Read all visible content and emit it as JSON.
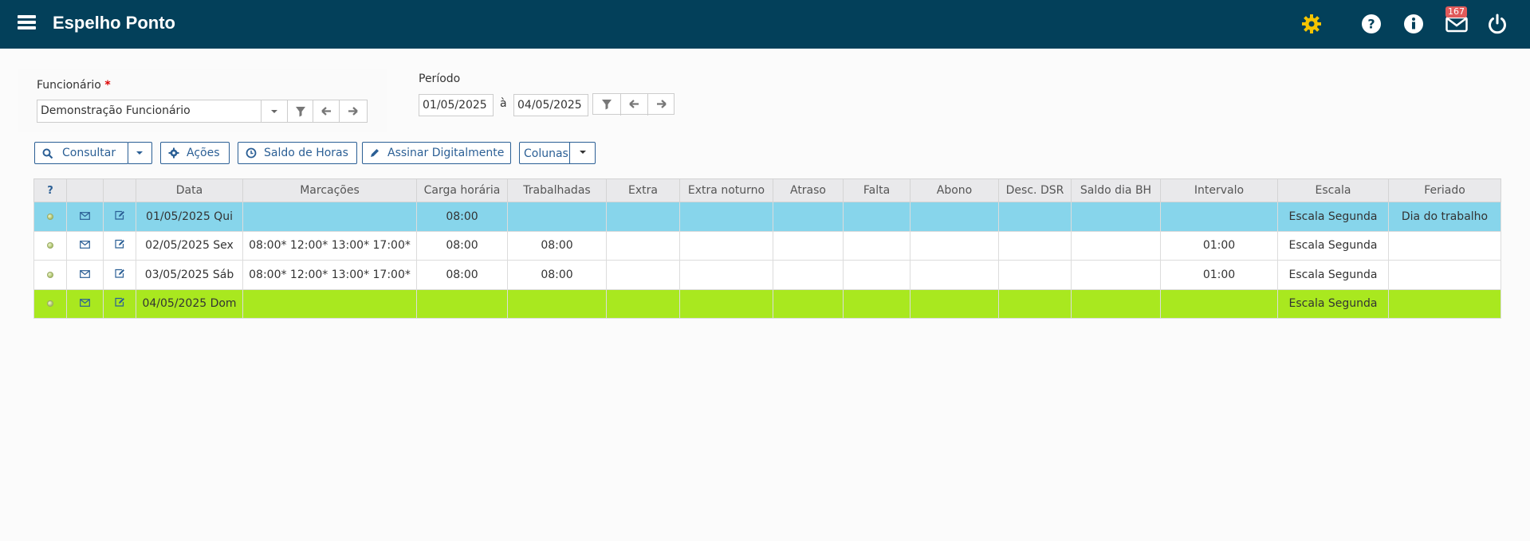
{
  "header": {
    "title": "Espelho Ponto",
    "mail_badge": "167",
    "icons": [
      "menu-icon",
      "gear-icon",
      "help-icon",
      "info-icon",
      "mail-icon",
      "power-icon"
    ],
    "colors": {
      "bar": "#03405a",
      "gear": "#f5c400",
      "badge": "#e05a5a"
    }
  },
  "filters": {
    "funcionario_label": "Funcionário",
    "required_mark": "*",
    "funcionario_value": "Demonstração Funcionário",
    "periodo_label": "Período",
    "start_date": "01/05/2025",
    "date_separator": "à",
    "end_date": "04/05/2025"
  },
  "toolbar": {
    "consultar": "Consultar",
    "acoes": "Ações",
    "saldo_horas": "Saldo de Horas",
    "assinar": "Assinar Digitalmente",
    "colunas": "Colunas"
  },
  "table": {
    "headers": {
      "q": "?",
      "data": "Data",
      "marcacoes": "Marcações",
      "carga": "Carga horária",
      "trabalhadas": "Trabalhadas",
      "extra": "Extra",
      "extra_noturno": "Extra noturno",
      "atraso": "Atraso",
      "falta": "Falta",
      "abono": "Abono",
      "desc_dsr": "Desc. DSR",
      "saldo_bh": "Saldo dia BH",
      "intervalo": "Intervalo",
      "escala": "Escala",
      "feriado": "Feriado"
    },
    "rows": [
      {
        "data": "01/05/2025 Qui",
        "marcacoes": "",
        "carga": "08:00",
        "trabalhadas": "",
        "extra": "",
        "extra_noturno": "",
        "atraso": "",
        "falta": "",
        "abono": "",
        "desc_dsr": "",
        "saldo_bh": "",
        "intervalo": "",
        "escala": "Escala Segunda",
        "feriado": "Dia do trabalho",
        "row_color": "#87d5eb"
      },
      {
        "data": "02/05/2025 Sex",
        "marcacoes": "08:00* 12:00* 13:00* 17:00*",
        "carga": "08:00",
        "trabalhadas": "08:00",
        "extra": "",
        "extra_noturno": "",
        "atraso": "",
        "falta": "",
        "abono": "",
        "desc_dsr": "",
        "saldo_bh": "",
        "intervalo": "01:00",
        "escala": "Escala Segunda",
        "feriado": "",
        "row_color": "#ffffff"
      },
      {
        "data": "03/05/2025 Sáb",
        "marcacoes": "08:00* 12:00* 13:00* 17:00*",
        "carga": "08:00",
        "trabalhadas": "08:00",
        "extra": "",
        "extra_noturno": "",
        "atraso": "",
        "falta": "",
        "abono": "",
        "desc_dsr": "",
        "saldo_bh": "",
        "intervalo": "01:00",
        "escala": "Escala Segunda",
        "feriado": "",
        "row_color": "#ffffff"
      },
      {
        "data": "04/05/2025 Dom",
        "marcacoes": "",
        "carga": "",
        "trabalhadas": "",
        "extra": "",
        "extra_noturno": "",
        "atraso": "",
        "falta": "",
        "abono": "",
        "desc_dsr": "",
        "saldo_bh": "",
        "intervalo": "",
        "escala": "Escala Segunda",
        "feriado": "",
        "row_color": "#a9e81f"
      }
    ]
  }
}
